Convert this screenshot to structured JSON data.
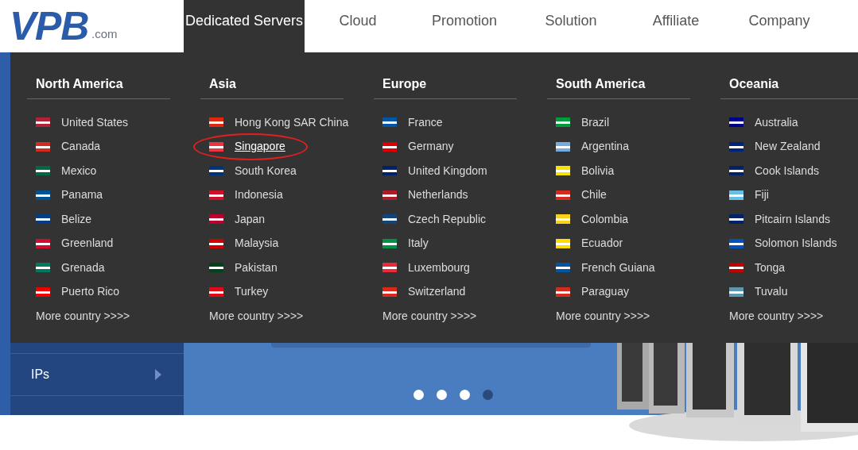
{
  "logo": {
    "mark": "VPB",
    "suffix": ".com"
  },
  "nav": [
    {
      "label": "Dedicated Servers",
      "selected": true
    },
    {
      "label": "Cloud",
      "selected": false
    },
    {
      "label": "Promotion",
      "selected": false
    },
    {
      "label": "Solution",
      "selected": false
    },
    {
      "label": "Affiliate",
      "selected": false
    },
    {
      "label": "Company",
      "selected": false
    }
  ],
  "regions": [
    {
      "title": "North America",
      "more": "More country >>>>",
      "countries": [
        {
          "name": "United States",
          "color": "#b22234",
          "highlighted": false
        },
        {
          "name": "Canada",
          "color": "#d52b1e",
          "highlighted": false
        },
        {
          "name": "Mexico",
          "color": "#006847",
          "highlighted": false
        },
        {
          "name": "Panama",
          "color": "#005293",
          "highlighted": false
        },
        {
          "name": "Belize",
          "color": "#003f87",
          "highlighted": false
        },
        {
          "name": "Greenland",
          "color": "#d00c33",
          "highlighted": false
        },
        {
          "name": "Grenada",
          "color": "#007a5e",
          "highlighted": false
        },
        {
          "name": "Puerto Rico",
          "color": "#ed0000",
          "highlighted": false
        }
      ]
    },
    {
      "title": "Asia",
      "more": "More country >>>>",
      "countries": [
        {
          "name": "Hong Kong SAR China",
          "color": "#de2910",
          "highlighted": false
        },
        {
          "name": "Singapore",
          "color": "#ef3340",
          "highlighted": true
        },
        {
          "name": "South Korea",
          "color": "#003478",
          "highlighted": false
        },
        {
          "name": "Indonesia",
          "color": "#ce1126",
          "highlighted": false
        },
        {
          "name": "Japan",
          "color": "#bc002d",
          "highlighted": false
        },
        {
          "name": "Malaysia",
          "color": "#cc0001",
          "highlighted": false
        },
        {
          "name": "Pakistan",
          "color": "#01411c",
          "highlighted": false
        },
        {
          "name": "Turkey",
          "color": "#e30a17",
          "highlighted": false
        }
      ]
    },
    {
      "title": "Europe",
      "more": "More country >>>>",
      "countries": [
        {
          "name": "France",
          "color": "#0055a4",
          "highlighted": false
        },
        {
          "name": "Germany",
          "color": "#dd0000",
          "highlighted": false
        },
        {
          "name": "United Kingdom",
          "color": "#012169",
          "highlighted": false
        },
        {
          "name": "Netherlands",
          "color": "#ae1c28",
          "highlighted": false
        },
        {
          "name": "Czech Republic",
          "color": "#11457e",
          "highlighted": false
        },
        {
          "name": "Italy",
          "color": "#009246",
          "highlighted": false
        },
        {
          "name": "Luxembourg",
          "color": "#ed2939",
          "highlighted": false
        },
        {
          "name": "Switzerland",
          "color": "#da291c",
          "highlighted": false
        }
      ]
    },
    {
      "title": "South America",
      "more": "More country >>>>",
      "countries": [
        {
          "name": "Brazil",
          "color": "#009c3b",
          "highlighted": false
        },
        {
          "name": "Argentina",
          "color": "#74acdf",
          "highlighted": false
        },
        {
          "name": "Bolivia",
          "color": "#f4e400",
          "highlighted": false
        },
        {
          "name": "Chile",
          "color": "#d52b1e",
          "highlighted": false
        },
        {
          "name": "Colombia",
          "color": "#fcd116",
          "highlighted": false
        },
        {
          "name": "Ecuador",
          "color": "#ffdd00",
          "highlighted": false
        },
        {
          "name": "French Guiana",
          "color": "#0055a4",
          "highlighted": false
        },
        {
          "name": "Paraguay",
          "color": "#d52b1e",
          "highlighted": false
        }
      ]
    },
    {
      "title": "Oceania",
      "more": "More country >>>>",
      "countries": [
        {
          "name": "Australia",
          "color": "#00008b",
          "highlighted": false
        },
        {
          "name": "New Zealand",
          "color": "#00247d",
          "highlighted": false
        },
        {
          "name": "Cook Islands",
          "color": "#012169",
          "highlighted": false
        },
        {
          "name": "Fiji",
          "color": "#68bfe5",
          "highlighted": false
        },
        {
          "name": "Pitcairn Islands",
          "color": "#012169",
          "highlighted": false
        },
        {
          "name": "Solomon Islands",
          "color": "#0051ba",
          "highlighted": false
        },
        {
          "name": "Tonga",
          "color": "#c10000",
          "highlighted": false
        },
        {
          "name": "Tuvalu",
          "color": "#5b97b1",
          "highlighted": false
        }
      ]
    }
  ],
  "sidebar": {
    "items": [
      {
        "label": "IPs"
      }
    ]
  },
  "carousel": {
    "dots": [
      {
        "selected": false
      },
      {
        "selected": false
      },
      {
        "selected": false
      },
      {
        "selected": true
      }
    ]
  }
}
